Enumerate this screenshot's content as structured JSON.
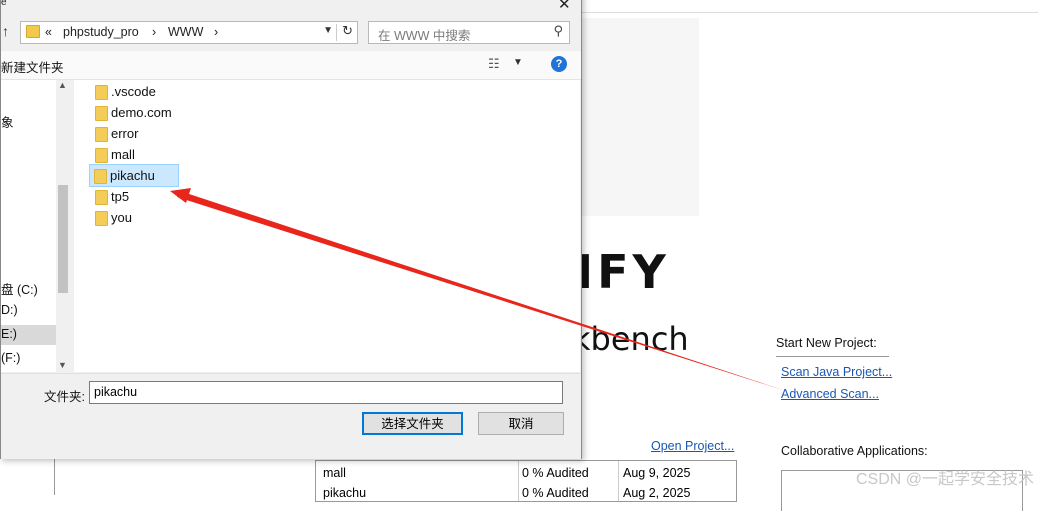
{
  "background_app": {
    "logo_text": "IFY",
    "subtitle": "kbench",
    "start_project_label": "Start New Project:",
    "scan_java_link": "Scan Java Project...",
    "advanced_scan_link": "Advanced Scan...",
    "open_project_link": "Open Project...",
    "collab_label": "Collaborative Applications:",
    "projects_table": [
      {
        "name": "mall",
        "audit": "0 % Audited",
        "date": "Aug 9, 2025"
      },
      {
        "name": "pikachu",
        "audit": "0 % Audited",
        "date": "Aug 2, 2025"
      }
    ],
    "watermark": "CSDN @一起学安全技术"
  },
  "dialog": {
    "title_stub": "e",
    "address": {
      "prefix": "«",
      "segments": [
        "phpstudy_pro",
        "WWW"
      ],
      "separator": "›"
    },
    "search_placeholder": "在 WWW 中搜索",
    "new_folder_label": "新建文件夹",
    "help_icon_text": "?",
    "nav_items": [
      {
        "label": "象",
        "selected": false
      },
      {
        "label": "盘 (C:)",
        "selected": false
      },
      {
        "label": "D:)",
        "selected": false
      },
      {
        "label": "E:)",
        "selected": true
      },
      {
        "label": "(F:)",
        "selected": false
      }
    ],
    "folders": [
      {
        "name": ".vscode",
        "selected": false
      },
      {
        "name": "demo.com",
        "selected": false
      },
      {
        "name": "error",
        "selected": false
      },
      {
        "name": "mall",
        "selected": false
      },
      {
        "name": "pikachu",
        "selected": true
      },
      {
        "name": "tp5",
        "selected": false
      },
      {
        "name": "you",
        "selected": false
      }
    ],
    "folder_field_label": "文件夹:",
    "folder_field_value": "pikachu",
    "select_button": "选择文件夹",
    "cancel_button": "取消"
  },
  "colors": {
    "annotation_arrow": "#e8261c",
    "link": "#1a57b5",
    "selection_bg": "#cce8ff"
  }
}
